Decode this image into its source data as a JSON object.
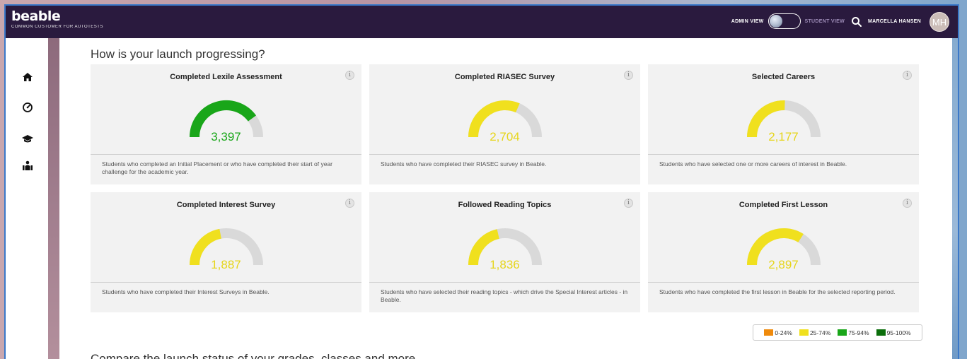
{
  "header": {
    "logo": "beable",
    "customer": "COMMON CUSTOMER FOR AUTOTESTS",
    "admin_view_label": "ADMIN VIEW",
    "student_view_label": "STUDENT VIEW",
    "user_name": "MARCELLA HANSEN",
    "avatar_initials": "MH"
  },
  "nav": {
    "items": [
      {
        "name": "home-icon"
      },
      {
        "name": "dashboard-gauge-icon"
      },
      {
        "name": "graduation-cap-icon"
      },
      {
        "name": "reports-people-icon"
      }
    ]
  },
  "main": {
    "title": "How is your launch progressing?",
    "section2_title": "Compare the launch status of your grades, classes and more",
    "cards": [
      {
        "title": "Completed Lexile Assessment",
        "value": "3,397",
        "fraction": 0.8,
        "color": "#19a619",
        "description": "Students who completed an Initial Placement or who have completed their start of year challenge for the academic year."
      },
      {
        "title": "Completed RIASEC Survey",
        "value": "2,704",
        "fraction": 0.63,
        "color": "#f0e01e",
        "description": "Students who have completed their RIASEC survey in Beable."
      },
      {
        "title": "Selected Careers",
        "value": "2,177",
        "fraction": 0.51,
        "color": "#f0e01e",
        "description": "Students who have selected one or more careers of interest in Beable."
      },
      {
        "title": "Completed Interest Survey",
        "value": "1,887",
        "fraction": 0.44,
        "color": "#f0e01e",
        "description": "Students who have completed their Interest Surveys in Beable."
      },
      {
        "title": "Followed Reading Topics",
        "value": "1,836",
        "fraction": 0.43,
        "color": "#f0e01e",
        "description": "Students who have selected their reading topics - which drive the Special Interest articles - in Beable."
      },
      {
        "title": "Completed First Lesson",
        "value": "2,897",
        "fraction": 0.68,
        "color": "#f0e01e",
        "description": "Students who have completed the first lesson in Beable for the selected reporting period."
      }
    ],
    "legend": [
      {
        "label": "0-24%",
        "color": "#ef8a0c"
      },
      {
        "label": "25-74%",
        "color": "#f0e01e"
      },
      {
        "label": "75-94%",
        "color": "#19a619"
      },
      {
        "label": "95-100%",
        "color": "#0b6e0b"
      }
    ]
  }
}
